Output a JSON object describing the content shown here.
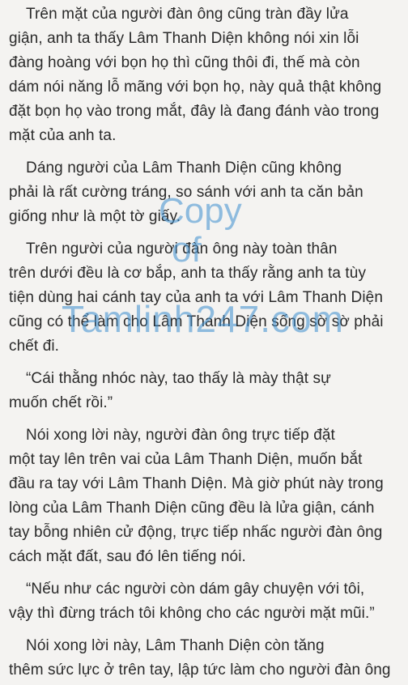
{
  "paragraphs": [
    {
      "lines": [
        "Trên mặt của người đàn ông cũng tràn đầy lửa",
        "giận, anh ta thấy Lâm Thanh Diện không nói xin lỗi",
        "đàng hoàng với bọn họ thì cũng thôi đi, thế mà còn",
        "dám nói năng lỗ mãng với bọn họ, này quả thật không",
        "đặt bọn họ vào trong mắt, đây là đang đánh vào trong",
        "mặt của anh ta."
      ]
    },
    {
      "lines": [
        "Dáng người của Lâm Thanh Diện cũng không",
        "phải là rất cường tráng, so sánh với anh ta căn bản",
        "giống như là một tờ giấy."
      ]
    },
    {
      "lines": [
        "Trên người của người đàn ông này toàn thân",
        "trên dưới đều là cơ bắp, anh ta thấy rằng anh ta tùy",
        "tiện dùng hai cánh tay của anh ta với Lâm Thanh Diện",
        "cũng có thể làm cho Lâm Thanh Diện sống sờ sờ phải",
        "chết đi."
      ]
    },
    {
      "lines": [
        "“Cái thằng nhóc này, tao thấy là mày thật sự",
        "muốn chết rồi.”"
      ]
    },
    {
      "lines": [
        "Nói xong lời này, người đàn ông trực tiếp đặt",
        "một tay lên trên vai của Lâm Thanh Diện, muốn bắt",
        "đầu ra tay với Lâm Thanh Diện. Mà giờ phút này trong",
        "lòng của Lâm Thanh Diện cũng đều là lửa giận, cánh",
        "tay bỗng nhiên cử động, trực tiếp nhấc người đàn ông",
        "cách mặt đất, sau đó lên tiếng nói."
      ]
    },
    {
      "lines": [
        "“Nếu như các người còn dám gây chuyện với tôi,",
        "vậy thì đừng trách tôi không cho các người mặt mũi.”"
      ]
    },
    {
      "lines": [
        "Nói xong lời này, Lâm Thanh Diện còn tăng",
        "thêm sức lực ở trên tay, lập tức làm cho người đàn ông"
      ]
    }
  ],
  "watermark": {
    "copy": "Copy",
    "of": "of",
    "site": "Tamlinh247.com",
    "color": "#3b8fd0"
  }
}
